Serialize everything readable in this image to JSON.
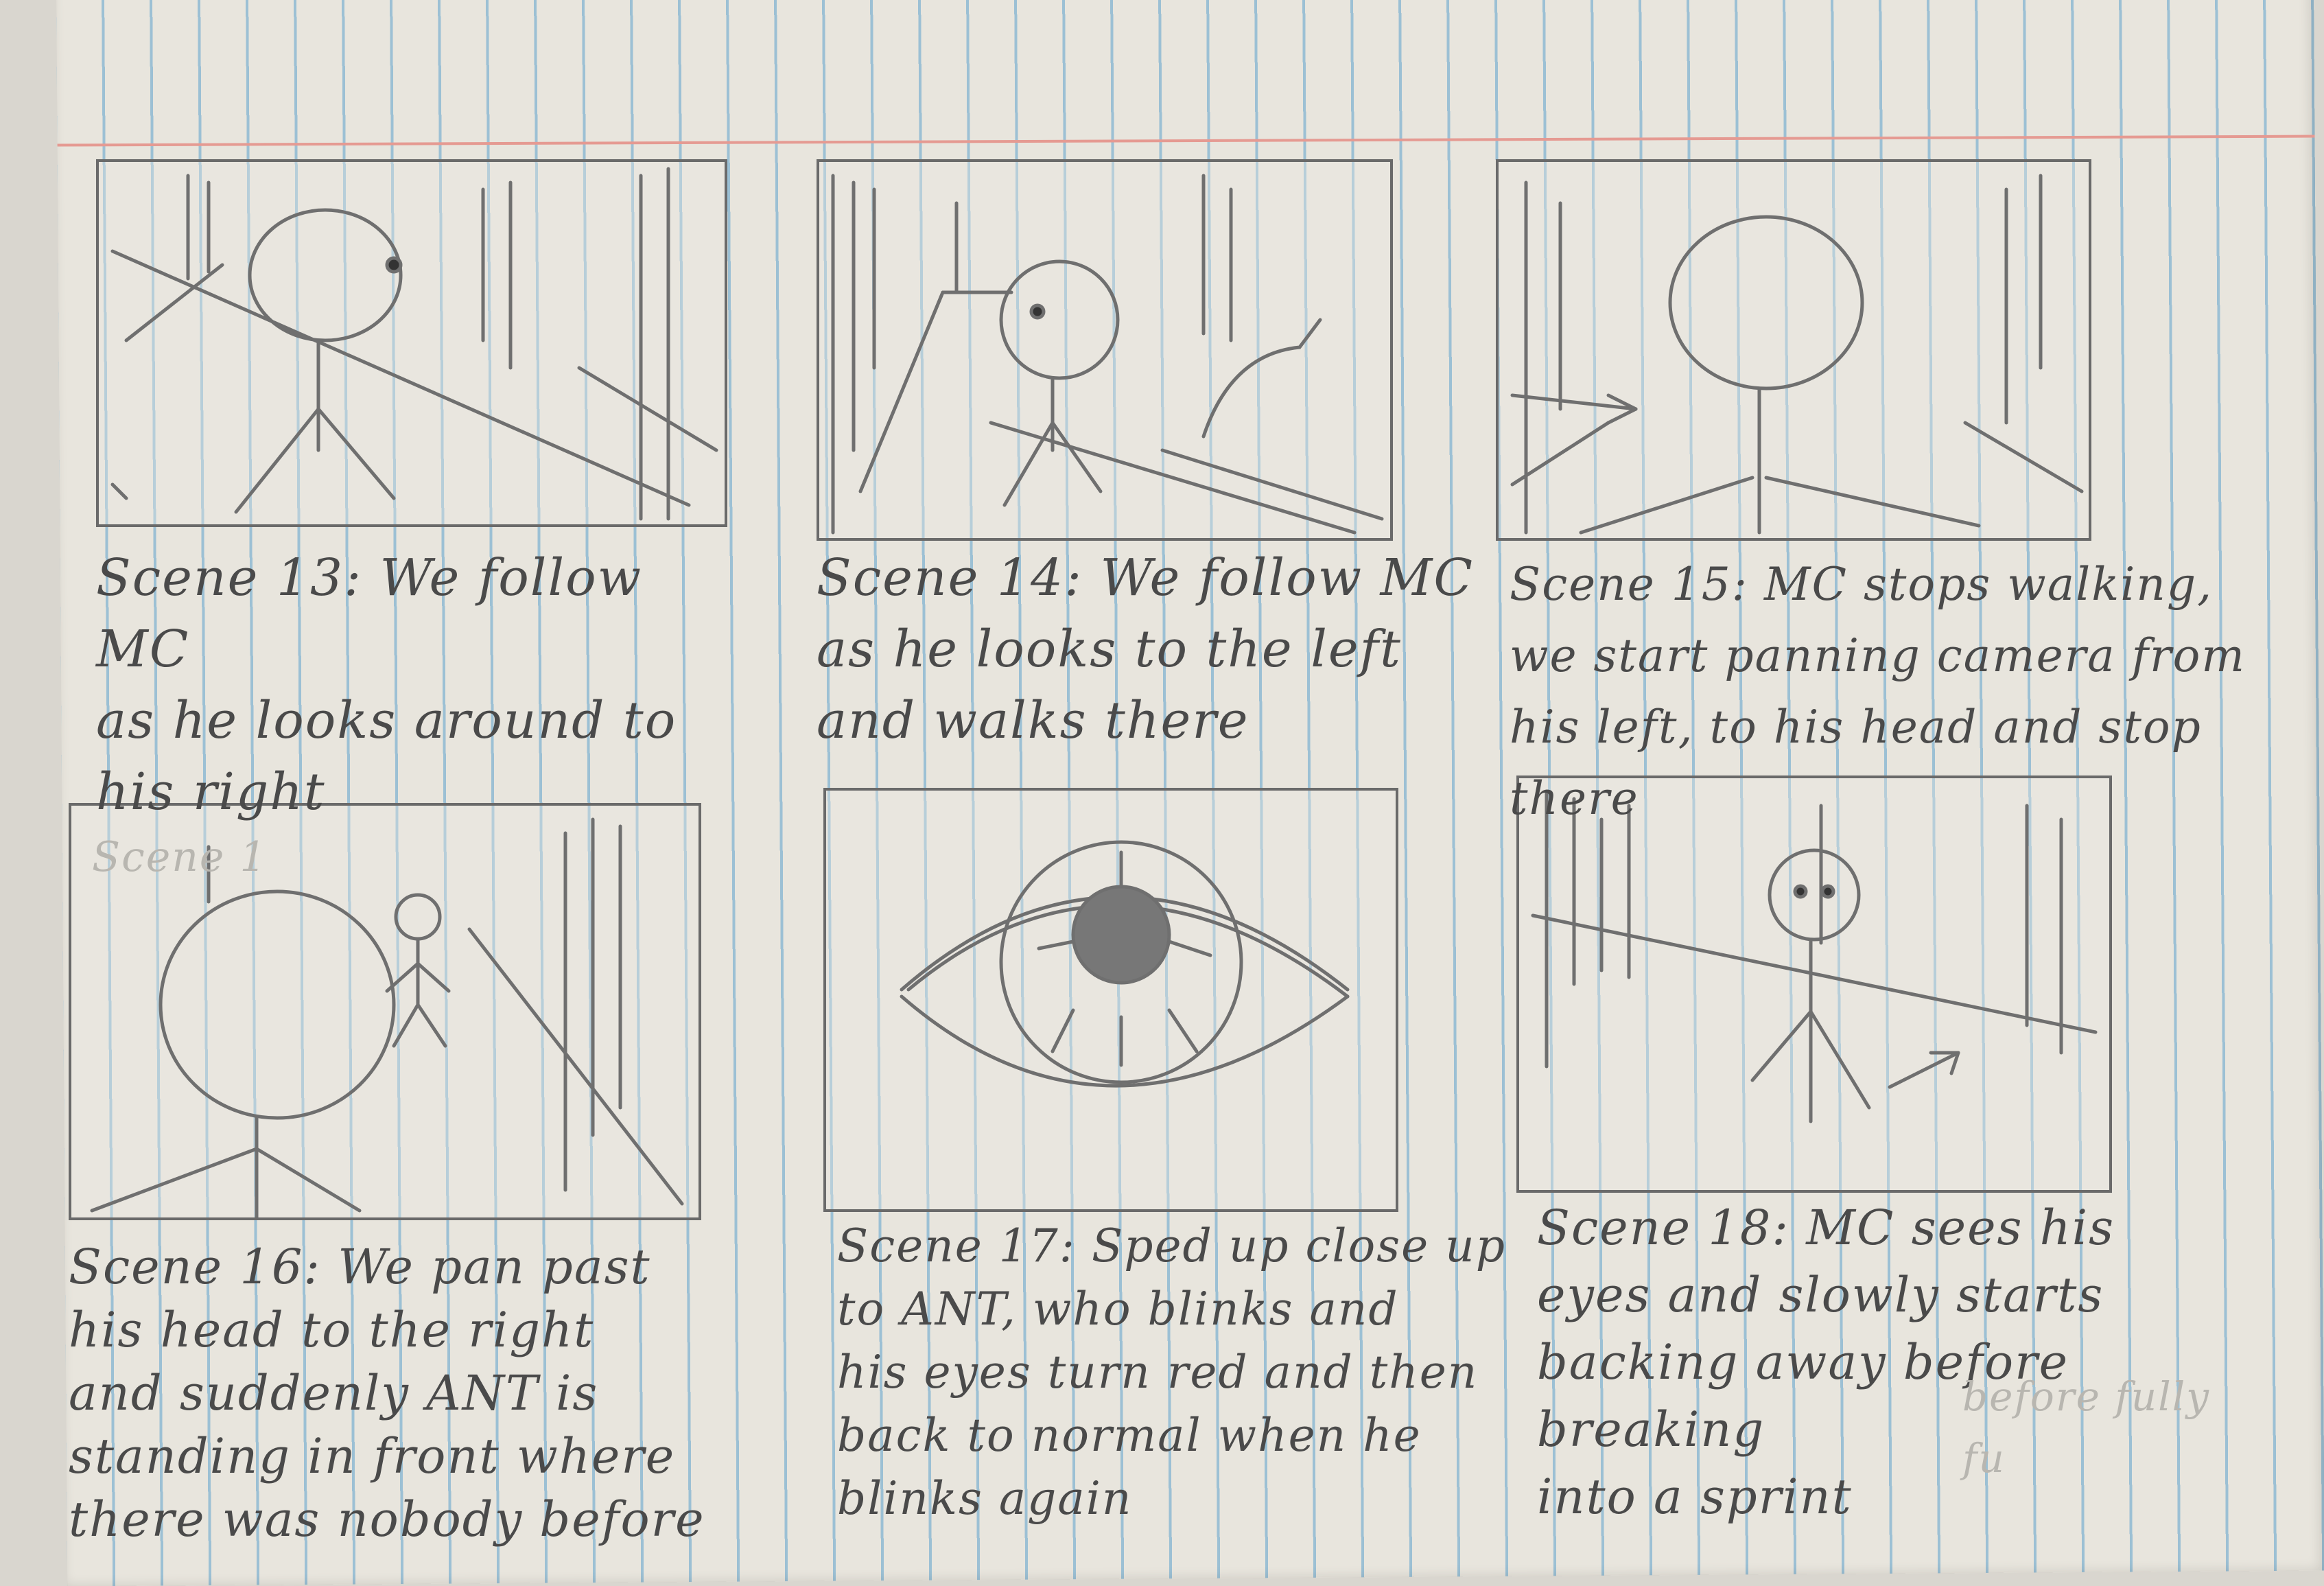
{
  "scenes": [
    {
      "caption": "Scene 13: We follow MC\nas he looks around to\nhis right"
    },
    {
      "caption": "Scene 14: We follow MC\nas he looks to the left\nand walks there"
    },
    {
      "caption": "Scene 15: MC stops walking,\nwe start panning camera from\nhis left, to his head and stop there"
    },
    {
      "caption": "Scene 16: We pan past\nhis head to the right\nand suddenly ANT is\nstanding in front where\nthere was nobody before"
    },
    {
      "caption": "Scene 17: Sped up close up\nto ANT, who blinks and\nhis eyes turn red and then\nback to normal when he\nblinks again"
    },
    {
      "caption": "Scene 18: MC sees his\neyes and slowly starts\nbacking away before breaking\ninto a sprint",
      "ghost": "before fully\nfu"
    }
  ],
  "panel16_ghost_label": "Scene 1"
}
